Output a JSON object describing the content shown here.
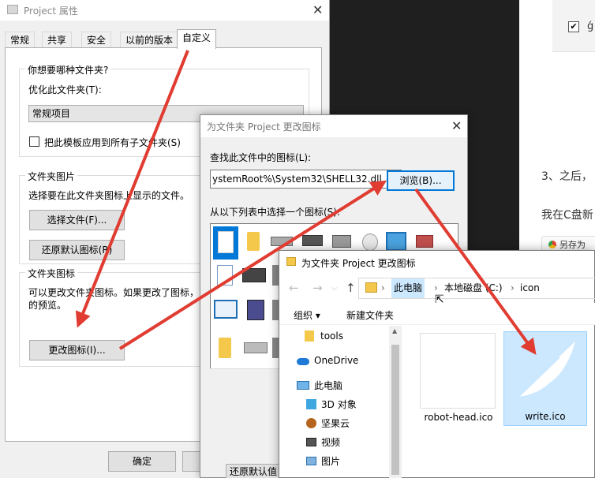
{
  "background": {
    "line1": "3、之后，",
    "line2": "我在C盘新",
    "save_label": "另存为"
  },
  "props_dialog": {
    "title": "Project 属性",
    "tabs": [
      "常规",
      "共享",
      "安全",
      "以前的版本",
      "自定义"
    ],
    "active_tab": "自定义",
    "group1_title": "你想要哪种文件夹?",
    "optimize_label": "优化此文件夹(T):",
    "optimize_value": "常规项目",
    "apply_template_label": "把此模板应用到所有子文件夹(S)",
    "group2_title": "文件夹图片",
    "choose_desc": "选择要在此文件夹图标上显示的文件。",
    "choose_file_btn": "选择文件(F)...",
    "restore_default_image_btn": "还原默认图标(R)",
    "group3_title": "文件夹图标",
    "icon_desc_line1": "可以更改文件夹图标。如果更改了图标，",
    "icon_desc_line2": "的预览。",
    "change_icon_btn": "更改图标(I)...",
    "ok_btn": "确定"
  },
  "change_icon_dialog": {
    "title": "为文件夹 Project 更改图标",
    "lookup_label": "查找此文件中的图标(L):",
    "path_value": "ystemRoot%\\System32\\SHELL32.dll",
    "browse_btn": "浏览(B)...",
    "select_label": "从以下列表中选择一个图标(S):",
    "restore_btn": "还原默认值"
  },
  "file_dialog": {
    "title": "为文件夹 Project 更改图标",
    "breadcrumbs": [
      "此电脑",
      "本地磁盘 (C:)",
      "icon"
    ],
    "organize": "组织 ▾",
    "new_folder": "新建文件夹",
    "tree": [
      "tools",
      "OneDrive",
      "此电脑",
      "3D 对象",
      "坚果云",
      "视频",
      "图片"
    ],
    "files": [
      "robot-head.ico",
      "write.ico"
    ],
    "selected_file": "write.ico"
  },
  "colors": {
    "accent": "#0078d7",
    "arrow": "#e03c31",
    "selection": "#cce8ff"
  }
}
